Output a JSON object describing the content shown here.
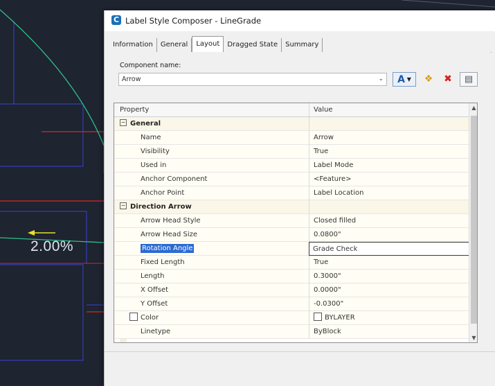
{
  "cad": {
    "grade_text": "2.00%"
  },
  "dialog": {
    "title": "Label Style Composer - LineGrade",
    "tabs": [
      "Information",
      "General",
      "Layout",
      "Dragged State",
      "Summary"
    ],
    "active_tab": "Layout",
    "component_name_label": "Component name:",
    "component_name_value": "Arrow",
    "grid_headers": {
      "property": "Property",
      "value": "Value"
    },
    "sections": [
      {
        "title": "General",
        "rows": [
          {
            "name": "Name",
            "value": "Arrow"
          },
          {
            "name": "Visibility",
            "value": "True"
          },
          {
            "name": "Used in",
            "value": "Label Mode"
          },
          {
            "name": "Anchor Component",
            "value": "<Feature>"
          },
          {
            "name": "Anchor Point",
            "value": "Label Location"
          }
        ]
      },
      {
        "title": "Direction Arrow",
        "rows": [
          {
            "name": "Arrow Head Style",
            "value": "Closed filled"
          },
          {
            "name": "Arrow Head Size",
            "value": "0.0800\""
          },
          {
            "name": "Rotation Angle",
            "value": "Grade Check"
          },
          {
            "name": "Fixed Length",
            "value": "True"
          },
          {
            "name": "Length",
            "value": "0.3000\""
          },
          {
            "name": "X Offset",
            "value": "0.0000\""
          },
          {
            "name": "Y Offset",
            "value": "-0.0300\""
          },
          {
            "name": "Color",
            "value": "BYLAYER"
          },
          {
            "name": "Linetype",
            "value": "ByBlock"
          }
        ]
      }
    ]
  },
  "colors": {
    "accent": "#2b6bd2",
    "cad_background": "#1e2430"
  }
}
